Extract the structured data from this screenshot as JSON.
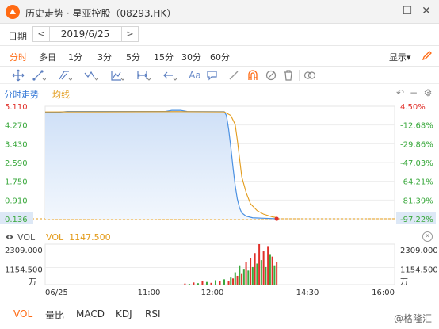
{
  "window": {
    "title": "历史走势 · 星亚控股（08293.HK）",
    "controls": [
      "restore",
      "close"
    ]
  },
  "date_bar": {
    "label": "日期",
    "prev": "<",
    "next": ">",
    "value": "2019/6/25"
  },
  "periods": {
    "items": [
      "分时",
      "多日",
      "1分",
      "3分",
      "5分",
      "15分",
      "30分",
      "60分"
    ],
    "active_index": 0,
    "display_label": "显示",
    "display_caret": "▾"
  },
  "toolbar": {
    "tools": [
      "crosshair-icon",
      "line-segment-icon",
      "channel-icon",
      "wave-icon",
      "indicator-icon",
      "range-icon",
      "arrow-icon",
      "text-tool",
      "comment-icon",
      "pen-icon",
      "magnet-icon",
      "hide-icon",
      "delete-icon",
      "link-icon"
    ],
    "text_tool_label": "Aa"
  },
  "chart_header": {
    "mode_label": "分时走势",
    "ma_label": "均线"
  },
  "chart_data": [
    {
      "type": "area",
      "title": "分时走势",
      "x_ticks": [
        "06/25",
        "11:00",
        "12:00",
        "14:30",
        "16:00"
      ],
      "y_left_ticks": [
        "5.110",
        "4.270",
        "3.430",
        "2.590",
        "1.750",
        "0.910",
        "0.136"
      ],
      "y_right_ticks": [
        "4.50%",
        "-12.68%",
        "-29.86%",
        "-47.03%",
        "-64.21%",
        "-81.39%",
        "-97.22%"
      ],
      "ylim": [
        0.136,
        5.11
      ],
      "ref_price": 0.136,
      "current_price_label": "0.136",
      "current_pct_label": "-97.22%",
      "series": [
        {
          "name": "分时走势",
          "color": "#4a90e2",
          "points": [
            [
              0,
              4.84
            ],
            [
              6,
              4.84
            ],
            [
              10,
              4.88
            ],
            [
              55,
              4.88
            ],
            [
              58,
              4.93
            ],
            [
              62,
              4.93
            ],
            [
              65,
              4.88
            ],
            [
              82,
              4.87
            ],
            [
              83,
              4.7
            ],
            [
              84,
              4.1
            ],
            [
              85,
              3.3
            ],
            [
              86,
              2.4
            ],
            [
              87,
              1.6
            ],
            [
              88,
              1.0
            ],
            [
              89,
              0.62
            ],
            [
              90,
              0.4
            ],
            [
              92,
              0.25
            ],
            [
              95,
              0.18
            ],
            [
              100,
              0.16
            ],
            [
              106,
              0.136
            ]
          ]
        },
        {
          "name": "均线",
          "color": "#e39b1a",
          "points": [
            [
              0,
              4.86
            ],
            [
              60,
              4.87
            ],
            [
              82,
              4.86
            ],
            [
              85,
              4.7
            ],
            [
              87,
              4.3
            ],
            [
              88,
              3.6
            ],
            [
              89,
              2.8
            ],
            [
              90,
              2.0
            ],
            [
              92,
              1.3
            ],
            [
              94,
              0.8
            ],
            [
              97,
              0.5
            ],
            [
              100,
              0.34
            ],
            [
              104,
              0.22
            ],
            [
              106,
              0.19
            ]
          ]
        }
      ]
    },
    {
      "type": "bar",
      "title": "VOL",
      "indicator_value": "1147.500",
      "y_ticks": [
        "2309.000",
        "1154.500"
      ],
      "y_unit": "万",
      "ylim": [
        0,
        2309
      ],
      "series": [
        {
          "name": "VOL",
          "values": [
            [
              64,
              60,
              "up"
            ],
            [
              66,
              40,
              "down"
            ],
            [
              68,
              120,
              "up"
            ],
            [
              70,
              80,
              "down"
            ],
            [
              72,
              200,
              "up"
            ],
            [
              74,
              150,
              "down"
            ],
            [
              76,
              100,
              "up"
            ],
            [
              78,
              250,
              "down"
            ],
            [
              80,
              180,
              "up"
            ],
            [
              82,
              300,
              "down"
            ],
            [
              84,
              220,
              "up"
            ],
            [
              85,
              400,
              "down"
            ],
            [
              86,
              350,
              "up"
            ],
            [
              87,
              700,
              "down"
            ],
            [
              88,
              500,
              "up"
            ],
            [
              89,
              1100,
              "down"
            ],
            [
              90,
              650,
              "up"
            ],
            [
              91,
              900,
              "down"
            ],
            [
              92,
              1300,
              "up"
            ],
            [
              93,
              800,
              "down"
            ],
            [
              94,
              1500,
              "up"
            ],
            [
              95,
              1000,
              "down"
            ],
            [
              96,
              1800,
              "up"
            ],
            [
              97,
              1200,
              "down"
            ],
            [
              98,
              2309,
              "up"
            ],
            [
              99,
              1400,
              "down"
            ],
            [
              100,
              1900,
              "up"
            ],
            [
              101,
              1000,
              "down"
            ],
            [
              102,
              2200,
              "up"
            ],
            [
              103,
              1700,
              "down"
            ],
            [
              104,
              1600,
              "up"
            ],
            [
              105,
              1100,
              "down"
            ],
            [
              106,
              1300,
              "up"
            ]
          ]
        }
      ]
    }
  ],
  "volume_panel": {
    "name": "VOL",
    "label": "VOL",
    "value": "1147.500"
  },
  "bottom_tabs": {
    "items": [
      "VOL",
      "量比",
      "MACD",
      "KDJ",
      "RSI"
    ],
    "active_index": 0
  },
  "watermark": "@格隆汇",
  "colors": {
    "accent": "#ff6a13",
    "price_line": "#4a90e2",
    "ma_line": "#e39b1a",
    "up": "#e0302a",
    "down": "#39a83c",
    "pct_up": "#e0302a",
    "pct_down": "#39a83c"
  }
}
